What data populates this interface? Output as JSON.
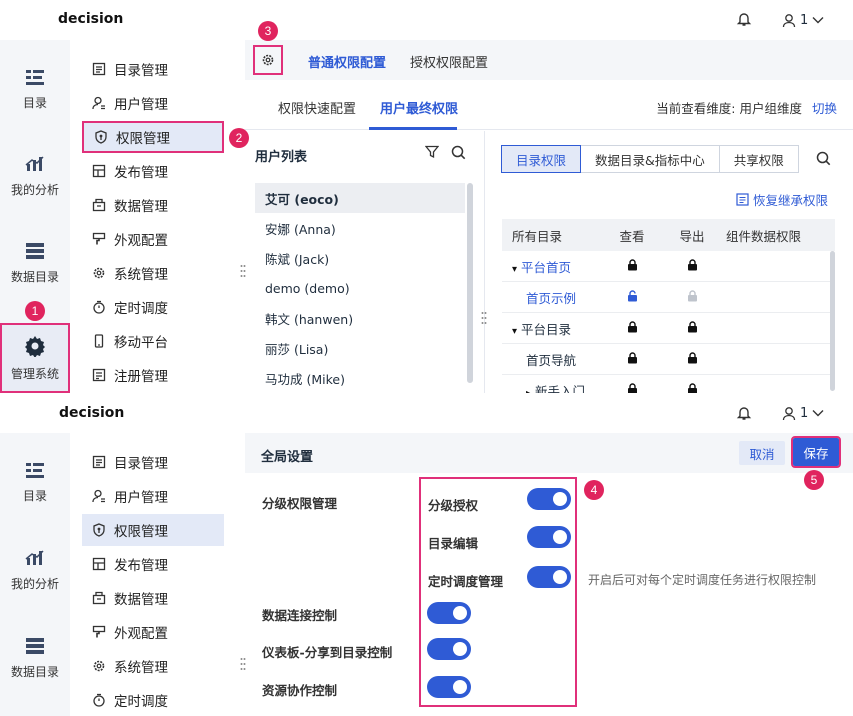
{
  "app": {
    "brand": "decision",
    "user": "1"
  },
  "rail": [
    "目录",
    "我的分析",
    "数据目录",
    "管理系统"
  ],
  "menu": [
    "目录管理",
    "用户管理",
    "权限管理",
    "发布管理",
    "数据管理",
    "外观配置",
    "系统管理",
    "定时调度",
    "移动平台",
    "注册管理"
  ],
  "badges": [
    "1",
    "2",
    "3",
    "4",
    "5"
  ],
  "panel1": {
    "top_tabs": [
      "普通权限配置",
      "授权权限配置"
    ],
    "sub_tabs": [
      "权限快速配置",
      "用户最终权限"
    ],
    "dimension_label": "当前查看维度: 用户组维度",
    "switch_label": "切换",
    "user_list_title": "用户列表",
    "users": [
      "艾可 (eoco)",
      "安娜 (Anna)",
      "陈斌 (Jack)",
      "demo (demo)",
      "韩文 (hanwen)",
      "丽莎 (Lisa)",
      "马功成 (Mike)"
    ],
    "perm_tabs": [
      "目录权限",
      "数据目录&指标中心",
      "共享权限"
    ],
    "restore_label": "恢复继承权限",
    "table_headers": [
      "所有目录",
      "查看",
      "导出",
      "组件数据权限"
    ],
    "rows": [
      {
        "name": "平台首页",
        "arrow": "▴",
        "view": "lock",
        "export": "lock",
        "blue": true,
        "indent": 0
      },
      {
        "name": "首页示例",
        "arrow": "",
        "view": "unlock",
        "export": "lock-grey",
        "blue": true,
        "indent": 1
      },
      {
        "name": "平台目录",
        "arrow": "▴",
        "view": "lock",
        "export": "lock",
        "blue": false,
        "indent": 0
      },
      {
        "name": "首页导航",
        "arrow": "",
        "view": "lock",
        "export": "lock",
        "blue": false,
        "indent": 1
      },
      {
        "name": "新手入门",
        "arrow": "▸",
        "view": "lock",
        "export": "lock",
        "blue": false,
        "indent": 1
      }
    ]
  },
  "panel2": {
    "title": "全局设置",
    "cancel": "取消",
    "save": "保存",
    "section_label": "分级权限管理",
    "sub_settings": [
      "分级授权",
      "目录编辑",
      "定时调度管理"
    ],
    "hint": "开启后可对每个定时调度任务进行权限控制",
    "settings": [
      "数据连接控制",
      "仪表板-分享到目录控制",
      "资源协作控制"
    ]
  },
  "colors": {
    "accent": "#2f5bd5",
    "highlight": "#e0307a",
    "badge": "#e0245e"
  }
}
